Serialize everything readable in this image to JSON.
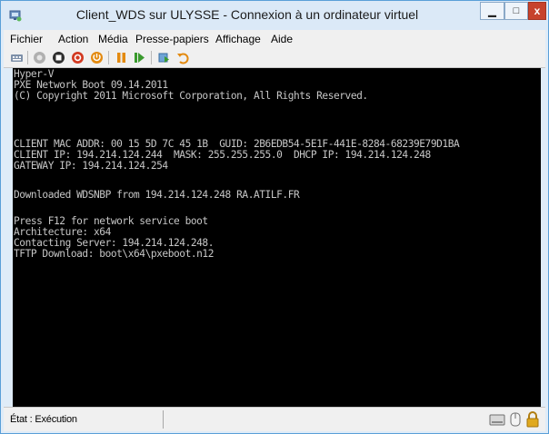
{
  "window": {
    "title": "Client_WDS sur ULYSSE - Connexion à un ordinateur virtuel",
    "controls": {
      "minimize": "▁",
      "maximize": "□",
      "close": "x"
    }
  },
  "menu": {
    "items": [
      "Fichier",
      "Action",
      "Média",
      "Presse-papiers",
      "Affichage",
      "Aide"
    ]
  },
  "toolbar": {
    "icons": [
      "ctrl-alt-del-icon",
      "start-icon",
      "turn-off-icon",
      "shutdown-icon",
      "save-icon",
      "pause-icon",
      "reset-icon",
      "snapshot-icon",
      "revert-icon"
    ],
    "accent_colors": {
      "disabled": "#9a9a9a",
      "red": "#d23a22",
      "orange": "#e38a10",
      "green": "#3a9a2e"
    }
  },
  "console": {
    "lines": [
      "Hyper-V",
      "PXE Network Boot 09.14.2011",
      "(C) Copyright 2011 Microsoft Corporation, All Rights Reserved.",
      "",
      "",
      "CLIENT MAC ADDR: 00 15 5D 7C 45 1B  GUID: 2B6EDB54-5E1F-441E-8284-68239E79D1BA",
      "CLIENT IP: 194.214.124.244  MASK: 255.255.255.0  DHCP IP: 194.214.124.248",
      "GATEWAY IP: 194.214.124.254",
      "",
      "Downloaded WDSNBP from 194.214.124.248 RA.ATILF.FR",
      "",
      "Press F12 for network service boot",
      "Architecture: x64",
      "Contacting Server: 194.214.124.248.",
      "TFTP Download: boot\\x64\\pxeboot.n12"
    ]
  },
  "status": {
    "text": "État : Exécution",
    "icons": [
      "disk-icon",
      "keyboard-icon",
      "lock-icon"
    ]
  }
}
